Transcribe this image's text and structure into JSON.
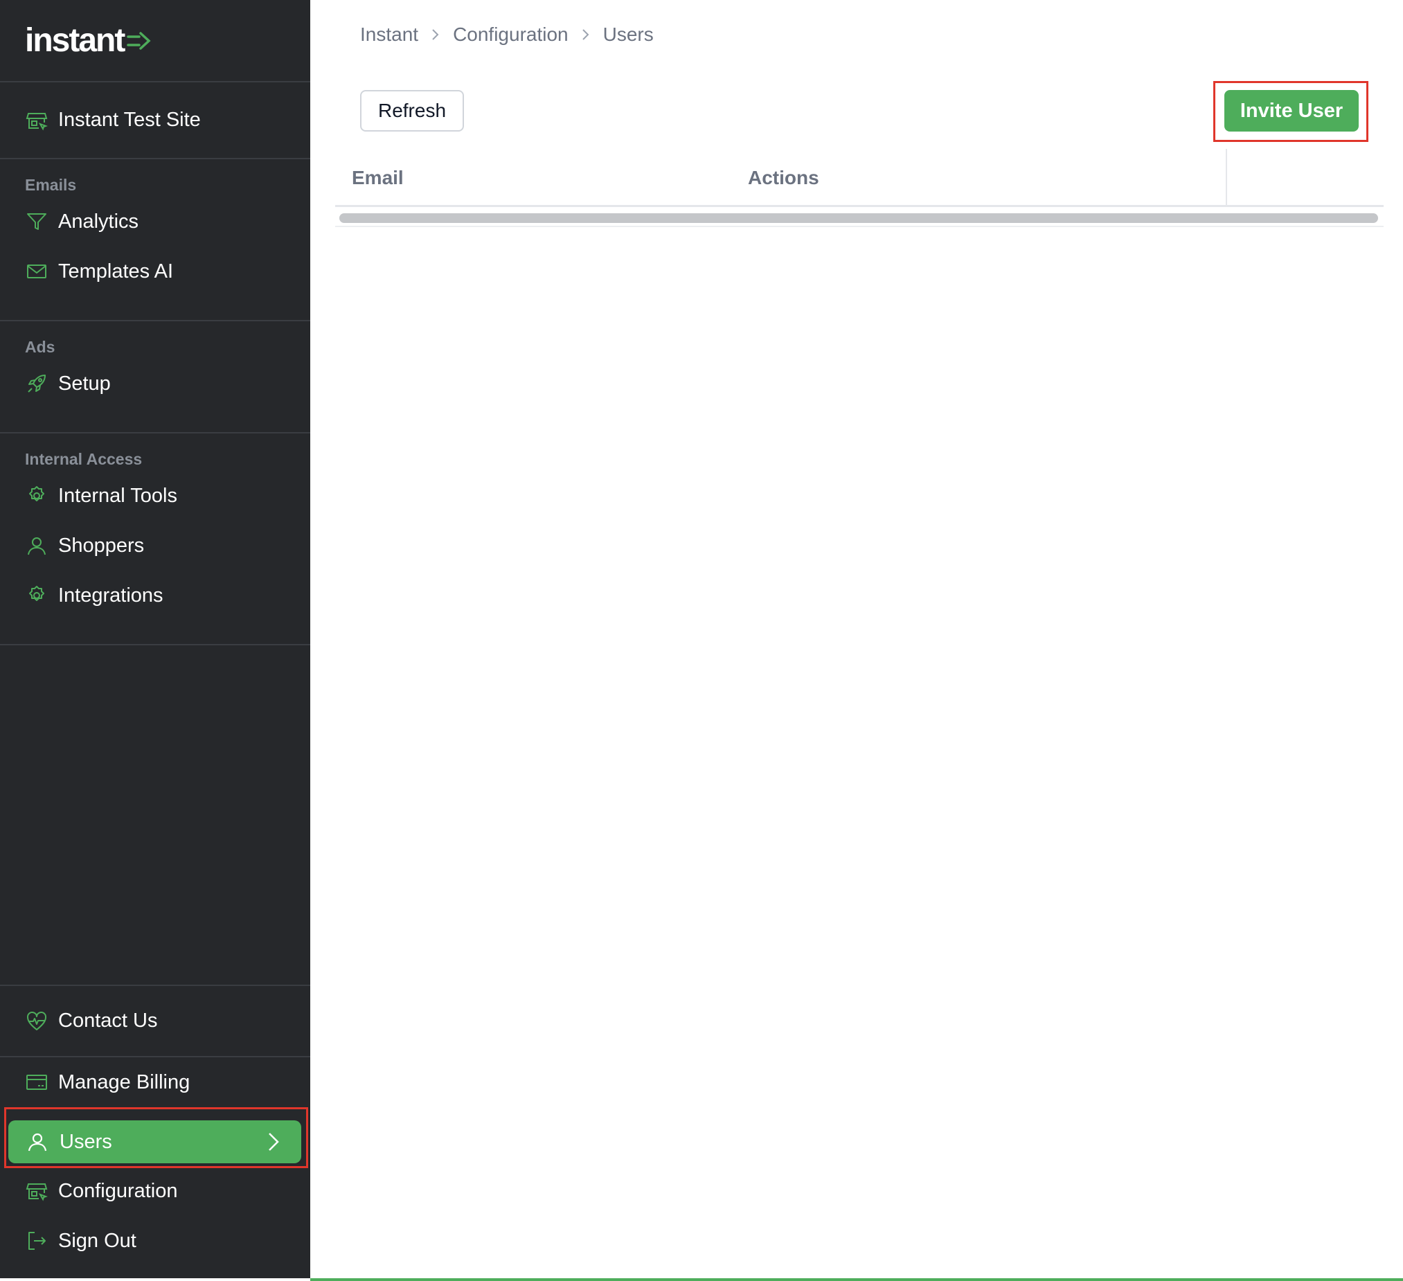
{
  "logo": {
    "text": "instant"
  },
  "site": {
    "name": "Instant Test Site"
  },
  "sidebar": {
    "sections": {
      "emails": {
        "title": "Emails",
        "items": [
          {
            "label": "Analytics"
          },
          {
            "label": "Templates AI"
          }
        ]
      },
      "ads": {
        "title": "Ads",
        "items": [
          {
            "label": "Setup"
          }
        ]
      },
      "internal": {
        "title": "Internal Access",
        "items": [
          {
            "label": "Internal Tools"
          },
          {
            "label": "Shoppers"
          },
          {
            "label": "Integrations"
          }
        ]
      }
    },
    "contact": {
      "label": "Contact Us"
    },
    "bottom": {
      "billing": "Manage Billing",
      "users": "Users",
      "configuration": "Configuration",
      "signout": "Sign Out"
    }
  },
  "breadcrumb": [
    "Instant",
    "Configuration",
    "Users"
  ],
  "toolbar": {
    "refresh_label": "Refresh",
    "invite_label": "Invite User"
  },
  "table": {
    "columns": [
      "Email",
      "Actions"
    ]
  },
  "colors": {
    "accent": "#4ead5b",
    "sidebar_bg": "#26282b",
    "highlight_outline": "#e0362b"
  }
}
